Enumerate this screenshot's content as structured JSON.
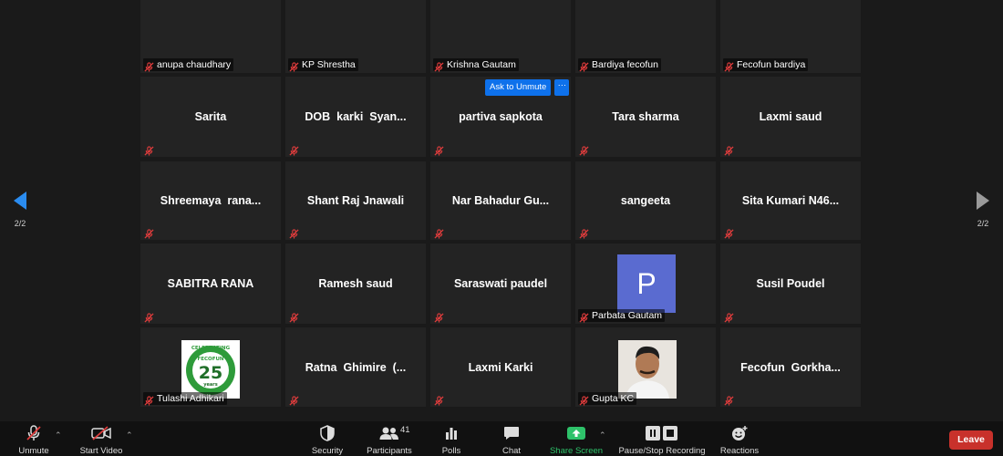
{
  "grid": {
    "tiles": [
      {
        "name": "anupa chaudhary",
        "style": "footer-only"
      },
      {
        "name": "KP Shrestha",
        "style": "footer-only"
      },
      {
        "name": "Krishna Gautam",
        "style": "footer-only"
      },
      {
        "name": "Bardiya fecofun",
        "style": "footer-only"
      },
      {
        "name": "Fecofun bardiya",
        "style": "footer-only"
      },
      {
        "name": "Sarita",
        "style": "center"
      },
      {
        "name": "DOB  karki  Syan...",
        "style": "center"
      },
      {
        "name": "partiva sapkota",
        "style": "center"
      },
      {
        "name": "Tara sharma",
        "style": "center"
      },
      {
        "name": "Laxmi saud",
        "style": "center"
      },
      {
        "name": "Shreemaya  rana...",
        "style": "center"
      },
      {
        "name": "Shant Raj Jnawali",
        "style": "center"
      },
      {
        "name": "Nar Bahadur Gu...",
        "style": "center"
      },
      {
        "name": "sangeeta",
        "style": "center"
      },
      {
        "name": "Sita Kumari N46...",
        "style": "center"
      },
      {
        "name": "SABITRA RANA",
        "style": "center"
      },
      {
        "name": "Ramesh saud",
        "style": "center"
      },
      {
        "name": "Saraswati paudel",
        "style": "center"
      },
      {
        "name": "Parbata Gautam",
        "style": "avatar",
        "avatar_letter": "P"
      },
      {
        "name": "Susil Poudel",
        "style": "center"
      },
      {
        "name": "Tulashi Adhikari",
        "style": "logo",
        "logo_text": "25",
        "logo_top": "FECOFUN",
        "logo_sub": "years",
        "logo_ring": "CELEBRATING"
      },
      {
        "name": "Ratna  Ghimire  (...",
        "style": "center"
      },
      {
        "name": "Laxmi Karki",
        "style": "center"
      },
      {
        "name": "Gupta KC",
        "style": "photo"
      },
      {
        "name": "Fecofun  Gorkha...",
        "style": "center"
      }
    ]
  },
  "ask_to_unmute": {
    "label": "Ask to Unmute",
    "more_label": "···"
  },
  "nav": {
    "prev_count": "2/2",
    "next_count": "2/2"
  },
  "toolbar": {
    "unmute": "Unmute",
    "start_video": "Start Video",
    "security": "Security",
    "participants": "Participants",
    "participants_count": "41",
    "polls": "Polls",
    "chat": "Chat",
    "share_screen": "Share Screen",
    "pause_recording": "Pause/Stop Recording",
    "reactions": "Reactions",
    "leave": "Leave"
  },
  "colors": {
    "accent_blue": "#0e71eb",
    "share_green": "#2ec26a",
    "leave_red": "#c8312b",
    "muted_red": "#e03c3c",
    "nav_arrow": "#2a8cf0"
  }
}
